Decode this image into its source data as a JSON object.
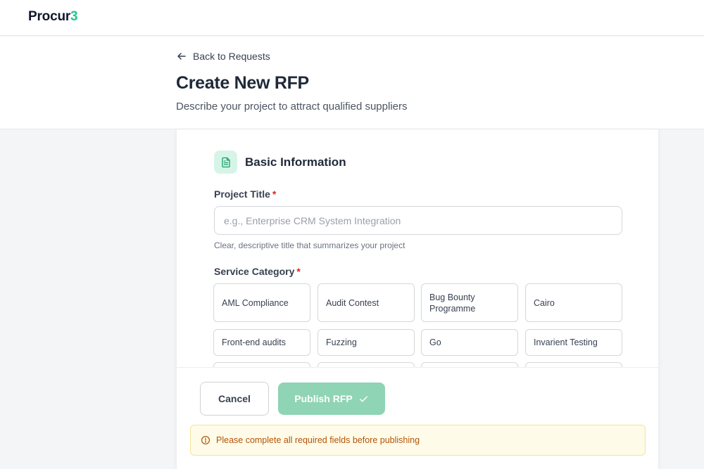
{
  "brand": {
    "name_main": "Procur",
    "name_accent": "3",
    "accent_color": "#22c58b"
  },
  "header": {
    "back_label": "Back to Requests",
    "title": "Create New RFP",
    "subtitle": "Describe your project to attract qualified suppliers"
  },
  "section": {
    "icon": "document-icon",
    "title": "Basic Information"
  },
  "project_title": {
    "label": "Project Title",
    "required_mark": "*",
    "value": "",
    "placeholder": "e.g., Enterprise CRM System Integration",
    "helper": "Clear, descriptive title that summarizes your project"
  },
  "service_category": {
    "label": "Service Category",
    "required_mark": "*",
    "options": [
      "AML Compliance",
      "Audit Contest",
      "Bug Bounty Programme",
      "Cairo",
      "Front-end audits",
      "Fuzzing",
      "Go",
      "Invarient Testing"
    ]
  },
  "actions": {
    "cancel_label": "Cancel",
    "publish_label": "Publish RFP",
    "publish_icon": "check-icon",
    "publish_color": "#8fd4b4"
  },
  "warning": {
    "icon": "info-circle-icon",
    "text": "Please complete all required fields before publishing",
    "color": "#b45309"
  }
}
